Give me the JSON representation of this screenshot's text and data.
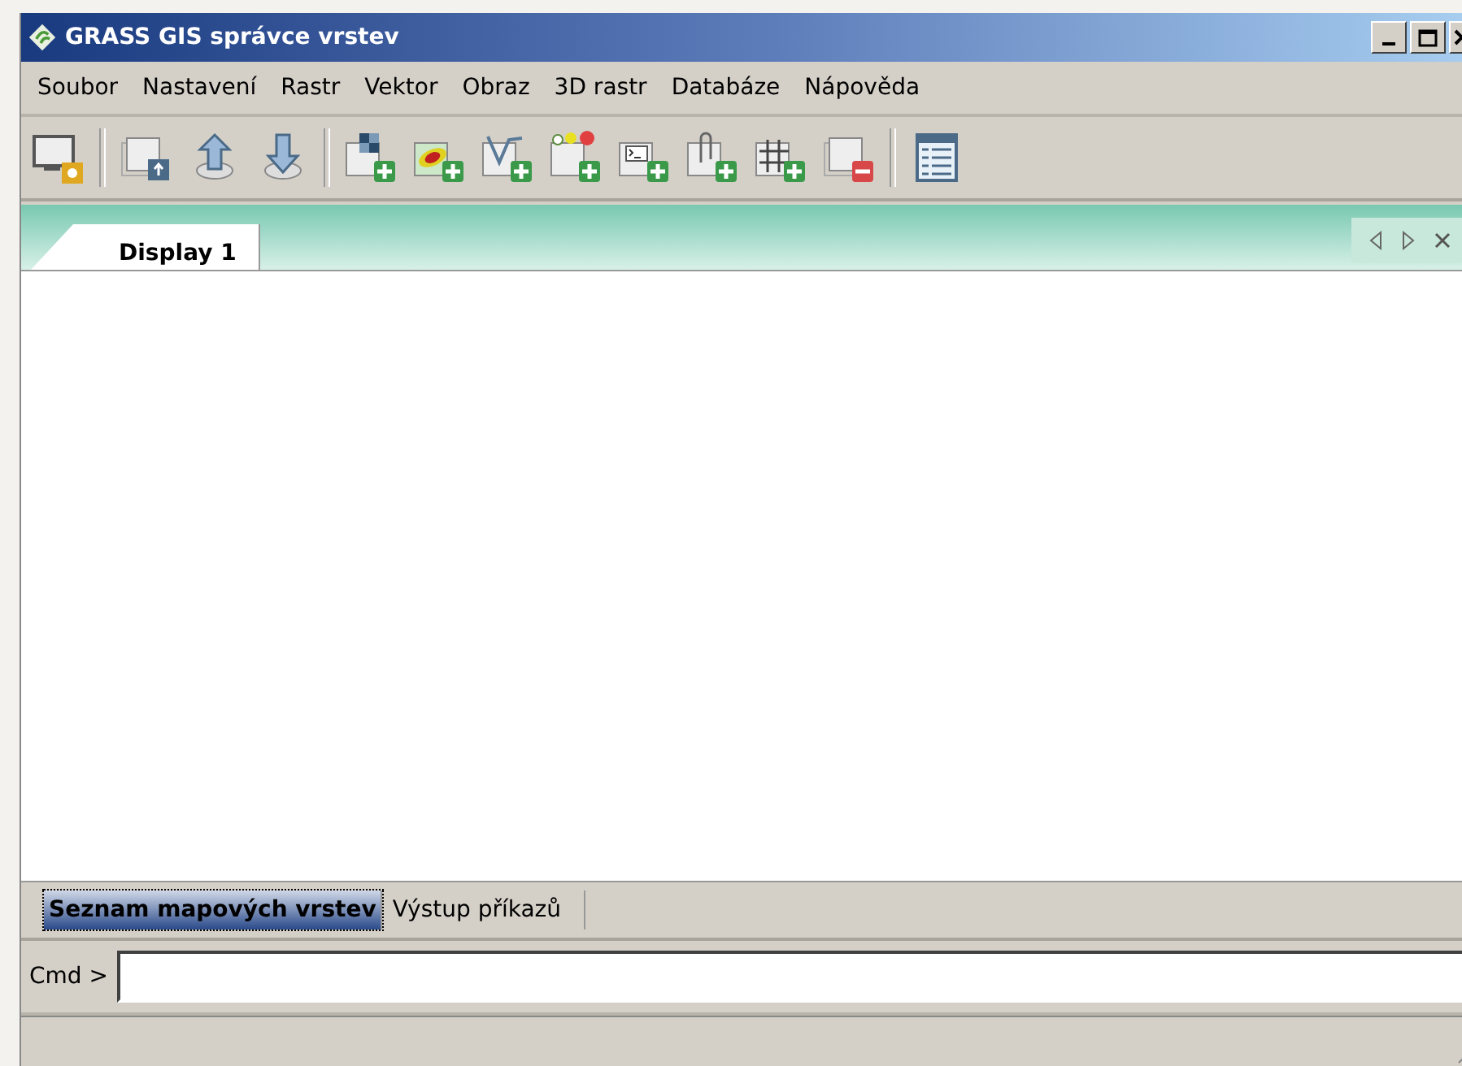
{
  "window": {
    "title": "GRASS GIS správce vrstev"
  },
  "menu": [
    "Soubor",
    "Nastavení",
    "Rastr",
    "Vektor",
    "Obraz",
    "3D rastr",
    "Databáze",
    "Nápověda"
  ],
  "display_tabs": [
    {
      "label": "Display 1",
      "selected": true
    }
  ],
  "bottom_tabs": [
    {
      "label": "Seznam mapových vrstev",
      "selected": true
    },
    {
      "label": "Výstup příkazů",
      "selected": false
    }
  ],
  "command": {
    "label": "Cmd >"
  }
}
